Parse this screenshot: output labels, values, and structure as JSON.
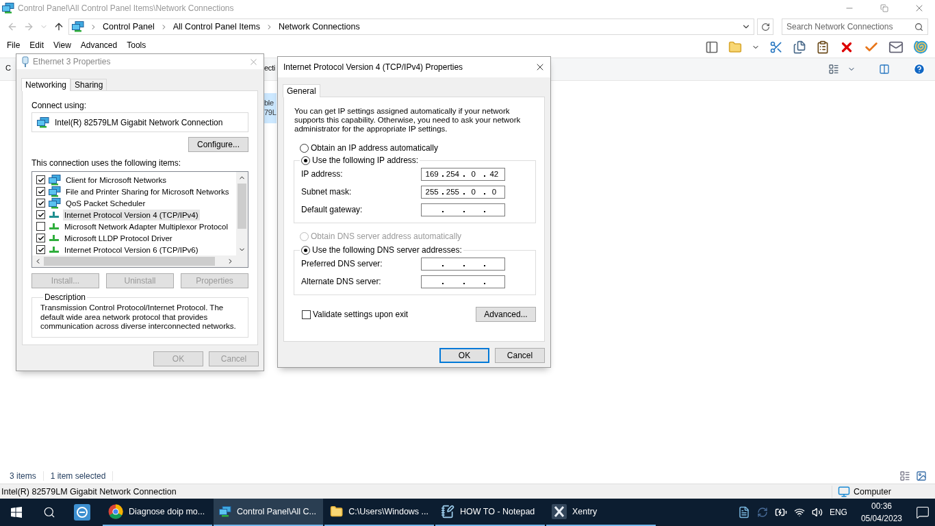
{
  "window": {
    "title": "Control Panel\\All Control Panel Items\\Network Connections"
  },
  "address_bar": {
    "crumbs": [
      "Control Panel",
      "All Control Panel Items",
      "Network Connections"
    ]
  },
  "search": {
    "placeholder": "Search Network Connections"
  },
  "menu": [
    "File",
    "Edit",
    "View",
    "Advanced",
    "Tools"
  ],
  "command_bar_fragments": [
    "C",
    "ecti"
  ],
  "item_fragment": [
    "ble",
    "79L"
  ],
  "status_bar": {
    "items": [
      "3 items",
      "1 item selected"
    ]
  },
  "details_bar": {
    "text": "Intel(R) 82579LM Gigabit Network Connection",
    "location": "Computer"
  },
  "ethernet_dialog": {
    "title": "Ethernet 3 Properties",
    "tabs": [
      {
        "label": "Networking",
        "selected": true
      },
      {
        "label": "Sharing",
        "selected": false
      }
    ],
    "connect_using_label": "Connect using:",
    "adapter": "Intel(R) 82579LM Gigabit Network Connection",
    "configure": "Configure...",
    "items_label": "This connection uses the following items:",
    "items": [
      {
        "label": "Client for Microsoft Networks",
        "checked": true,
        "selected": false,
        "kind": "service"
      },
      {
        "label": "File and Printer Sharing for Microsoft Networks",
        "checked": true,
        "selected": false,
        "kind": "service"
      },
      {
        "label": "QoS Packet Scheduler",
        "checked": true,
        "selected": false,
        "kind": "service"
      },
      {
        "label": "Internet Protocol Version 4 (TCP/IPv4)",
        "checked": true,
        "selected": true,
        "kind": "protocol"
      },
      {
        "label": "Microsoft Network Adapter Multiplexor Protocol",
        "checked": false,
        "selected": false,
        "kind": "protocol"
      },
      {
        "label": "Microsoft LLDP Protocol Driver",
        "checked": true,
        "selected": false,
        "kind": "protocol"
      },
      {
        "label": "Internet Protocol Version 6 (TCP/IPv6)",
        "checked": true,
        "selected": false,
        "kind": "protocol"
      }
    ],
    "buttons": [
      {
        "label": "Install...",
        "disabled": true
      },
      {
        "label": "Uninstall",
        "disabled": true
      },
      {
        "label": "Properties",
        "disabled": true
      }
    ],
    "description": {
      "legend": "Description",
      "text": "Transmission Control Protocol/Internet Protocol. The default wide area network protocol that provides communication across diverse interconnected networks."
    },
    "footer": [
      {
        "label": "OK",
        "disabled": true
      },
      {
        "label": "Cancel",
        "disabled": true
      }
    ]
  },
  "ipv4_dialog": {
    "title": "Internet Protocol Version 4 (TCP/IPv4) Properties",
    "tabs": [
      {
        "label": "General",
        "selected": true
      }
    ],
    "intro": "You can get IP settings assigned automatically if your network supports this capability. Otherwise, you need to ask your network administrator for the appropriate IP settings.",
    "ip_mode": [
      {
        "label": "Obtain an IP address automatically",
        "selected": false,
        "disabled": false
      },
      {
        "label": "Use the following IP address:",
        "selected": true,
        "disabled": false
      }
    ],
    "ip_fields": [
      {
        "label": "IP address:",
        "octets": [
          "169",
          "254",
          "0",
          "42"
        ]
      },
      {
        "label": "Subnet mask:",
        "octets": [
          "255",
          "255",
          "0",
          "0"
        ]
      },
      {
        "label": "Default gateway:"
      }
    ],
    "dns_mode": [
      {
        "label": "Obtain DNS server address automatically",
        "selected": false,
        "disabled": true
      },
      {
        "label": "Use the following DNS server addresses:",
        "selected": true,
        "disabled": false
      }
    ],
    "dns_fields": [
      {
        "label": "Preferred DNS server:"
      },
      {
        "label": "Alternate DNS server:"
      }
    ],
    "validate": {
      "label": "Validate settings upon exit",
      "checked": false
    },
    "advanced": "Advanced...",
    "footer": [
      {
        "label": "OK",
        "default": true
      },
      {
        "label": "Cancel",
        "default": false
      }
    ]
  },
  "taskbar": {
    "apps": [
      {
        "label": "Diagnose doip mo...",
        "kind": "chrome",
        "active": false
      },
      {
        "label": "Control Panel\\All C...",
        "kind": "control-panel",
        "active": true
      },
      {
        "label": "C:\\Users\\Windows ...",
        "kind": "folder",
        "active": false
      },
      {
        "label": "HOW TO - Notepad",
        "kind": "notepad",
        "active": false
      },
      {
        "label": "Xentry",
        "kind": "xentry",
        "active": false
      }
    ],
    "language": "ENG",
    "time": "00:36",
    "date": "05/04/2023"
  }
}
